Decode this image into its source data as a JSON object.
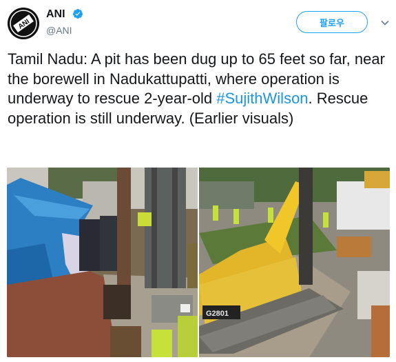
{
  "account": {
    "name": "ANI",
    "handle": "@ANI",
    "avatar_text": "ANI",
    "verified_icon": "verified-badge-icon"
  },
  "follow_button": {
    "label": "팔로우"
  },
  "menu_icon": "chevron-down-icon",
  "tweet": {
    "text_before": "Tamil Nadu: A pit has been dug up to 65 feet so far, near the borewell in Nadukattupatti, where operation is underway to rescue 2-year-old ",
    "hashtag": "#SujithWilson",
    "text_after": ". Rescue operation is still underway. (Earlier visuals)"
  },
  "media": {
    "right_machine_label": "G2801"
  },
  "colors": {
    "accent": "#1da1f2",
    "hashtag": "#1b95e0",
    "text": "#14171a",
    "secondary": "#657786"
  }
}
